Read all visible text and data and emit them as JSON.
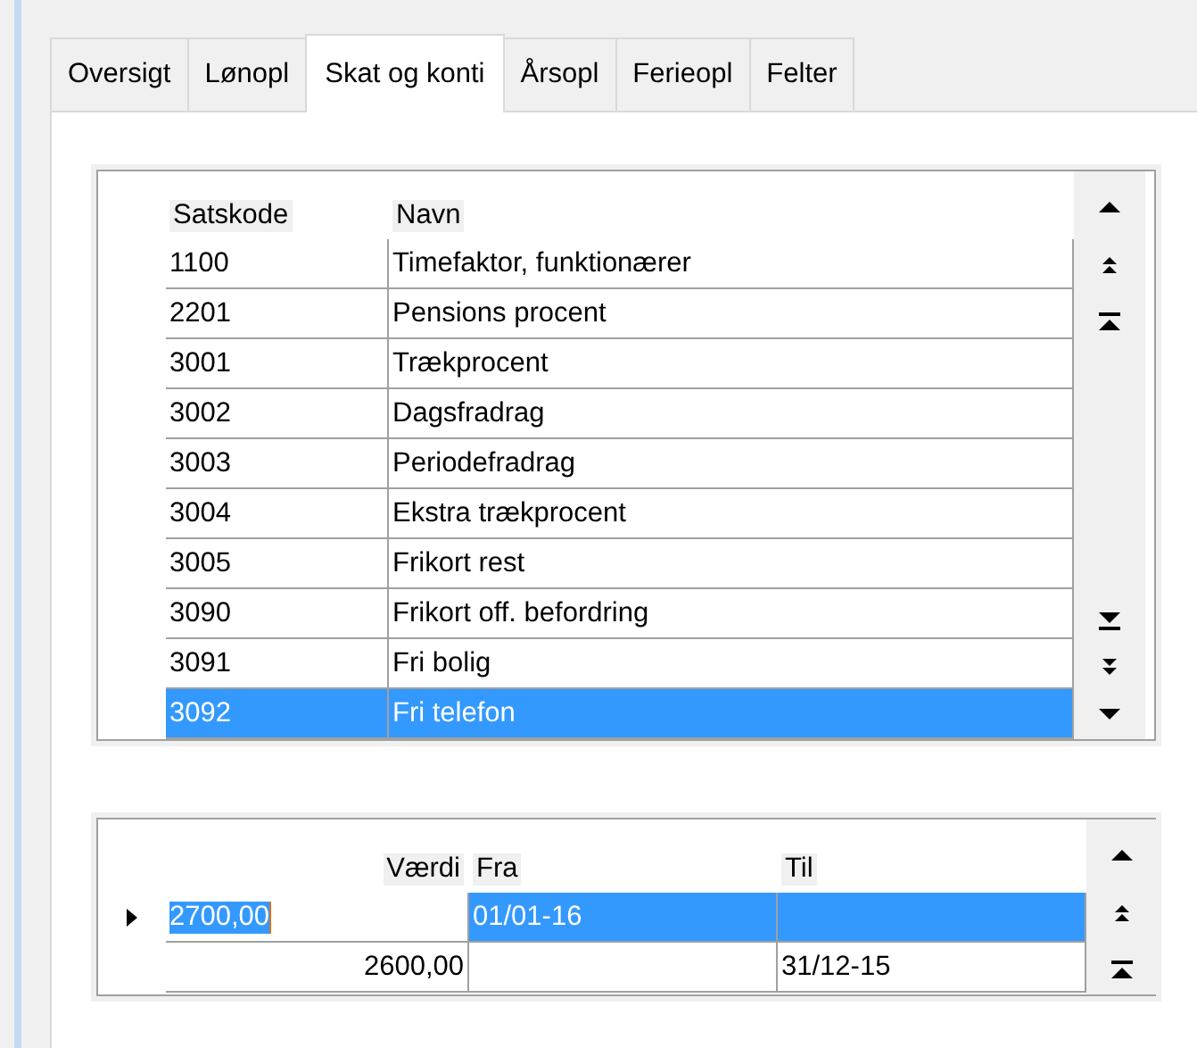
{
  "tabs": [
    {
      "label": "Oversigt",
      "selected": false
    },
    {
      "label": "Lønopl",
      "selected": false
    },
    {
      "label": "Skat og konti",
      "selected": true
    },
    {
      "label": "Årsopl",
      "selected": false
    },
    {
      "label": "Ferieopl",
      "selected": false
    },
    {
      "label": "Felter",
      "selected": false
    }
  ],
  "rates_table": {
    "columns": [
      {
        "label": "Satskode"
      },
      {
        "label": "Navn"
      }
    ],
    "rows": [
      {
        "cells": [
          "1100",
          "Timefaktor, funktionærer"
        ],
        "selected": false
      },
      {
        "cells": [
          "2201",
          "Pensions procent"
        ],
        "selected": false
      },
      {
        "cells": [
          "3001",
          "Trækprocent"
        ],
        "selected": false
      },
      {
        "cells": [
          "3002",
          "Dagsfradrag"
        ],
        "selected": false
      },
      {
        "cells": [
          "3003",
          "Periodefradrag"
        ],
        "selected": false
      },
      {
        "cells": [
          "3004",
          "Ekstra trækprocent"
        ],
        "selected": false
      },
      {
        "cells": [
          "3005",
          "Frikort rest"
        ],
        "selected": false
      },
      {
        "cells": [
          "3090",
          "Frikort off. befordring"
        ],
        "selected": false
      },
      {
        "cells": [
          "3091",
          "Fri bolig"
        ],
        "selected": false
      },
      {
        "cells": [
          "3092",
          "Fri telefon"
        ],
        "selected": true
      }
    ]
  },
  "values_table": {
    "columns": [
      {
        "label": "Værdi"
      },
      {
        "label": "Fra"
      },
      {
        "label": "Til"
      }
    ],
    "rows": [
      {
        "cells": [
          "2700,00",
          "01/01-16",
          ""
        ],
        "selected": true,
        "current": true,
        "editing": true
      },
      {
        "cells": [
          "2600,00",
          "",
          "31/12-15"
        ],
        "selected": false,
        "current": false,
        "editing": false
      }
    ]
  }
}
